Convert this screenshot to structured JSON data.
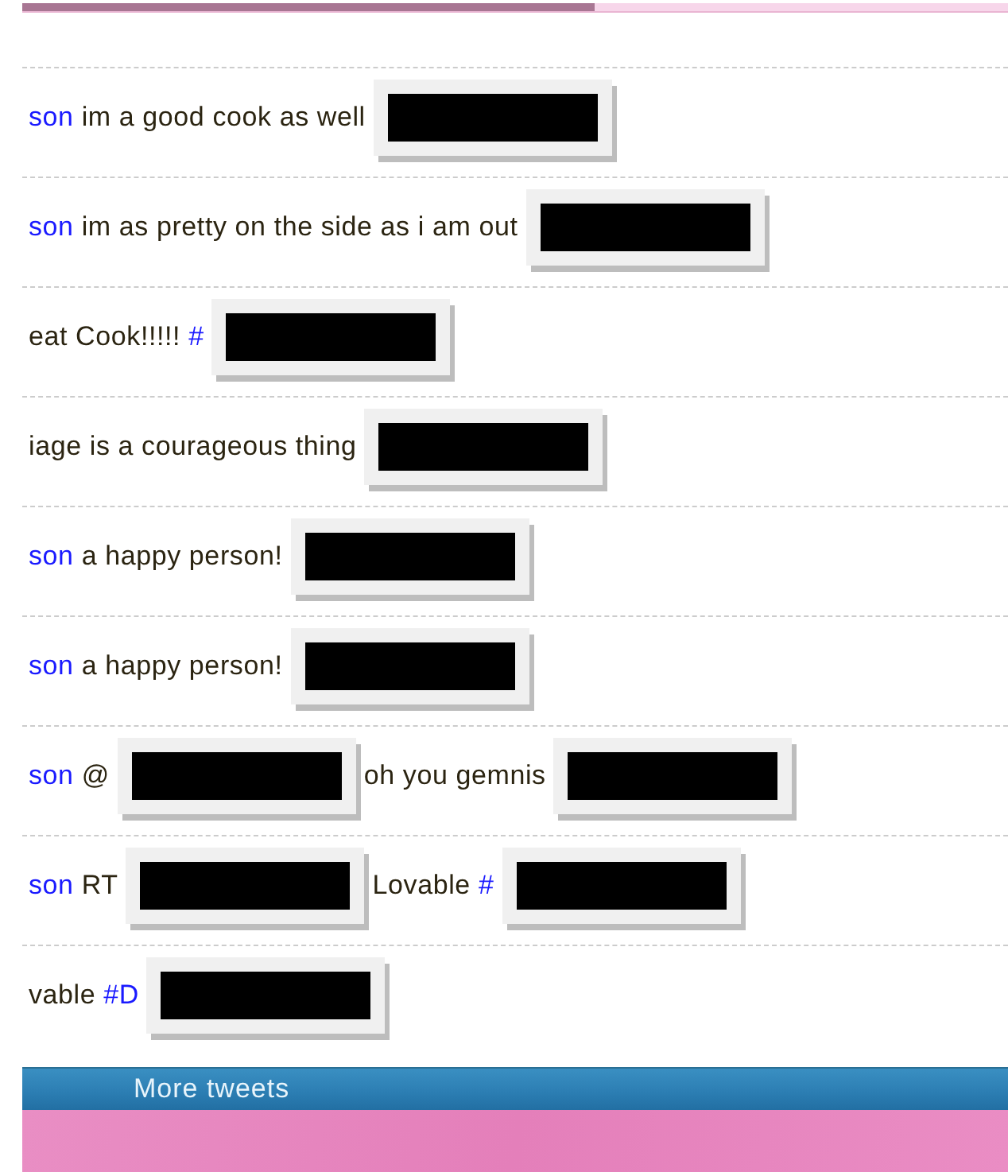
{
  "top_bar": {
    "level": 0.58
  },
  "tweets": [
    {
      "parts": [
        {
          "kind": "link",
          "text": "son"
        },
        {
          "kind": "text",
          "text": "im a good cook as well"
        },
        {
          "kind": "redacted"
        }
      ]
    },
    {
      "parts": [
        {
          "kind": "link",
          "text": "son"
        },
        {
          "kind": "text",
          "text": "im as pretty on the side as i am out"
        },
        {
          "kind": "redacted"
        }
      ]
    },
    {
      "parts": [
        {
          "kind": "text",
          "text": "eat Cook!!!!!"
        },
        {
          "kind": "link",
          "text": "#"
        },
        {
          "kind": "redacted"
        }
      ]
    },
    {
      "parts": [
        {
          "kind": "text",
          "text": "iage is a courageous thing"
        },
        {
          "kind": "redacted"
        }
      ]
    },
    {
      "parts": [
        {
          "kind": "link",
          "text": "son"
        },
        {
          "kind": "text",
          "text": "a happy person!"
        },
        {
          "kind": "redacted"
        }
      ]
    },
    {
      "parts": [
        {
          "kind": "link",
          "text": "son"
        },
        {
          "kind": "text",
          "text": "a happy person!"
        },
        {
          "kind": "redacted"
        }
      ]
    },
    {
      "parts": [
        {
          "kind": "link",
          "text": "son"
        },
        {
          "kind": "text",
          "text": "@"
        },
        {
          "kind": "redacted"
        },
        {
          "kind": "text",
          "text": "oh you gemnis"
        },
        {
          "kind": "redacted"
        }
      ]
    },
    {
      "parts": [
        {
          "kind": "link",
          "text": "son"
        },
        {
          "kind": "text",
          "text": "RT"
        },
        {
          "kind": "redacted"
        },
        {
          "kind": "text",
          "text": "Lovable"
        },
        {
          "kind": "link",
          "text": "#"
        },
        {
          "kind": "redacted"
        }
      ]
    },
    {
      "parts": [
        {
          "kind": "text",
          "text": "vable"
        },
        {
          "kind": "link",
          "text": "#D"
        },
        {
          "kind": "redacted"
        }
      ]
    }
  ],
  "more_button": {
    "label": "More tweets"
  }
}
